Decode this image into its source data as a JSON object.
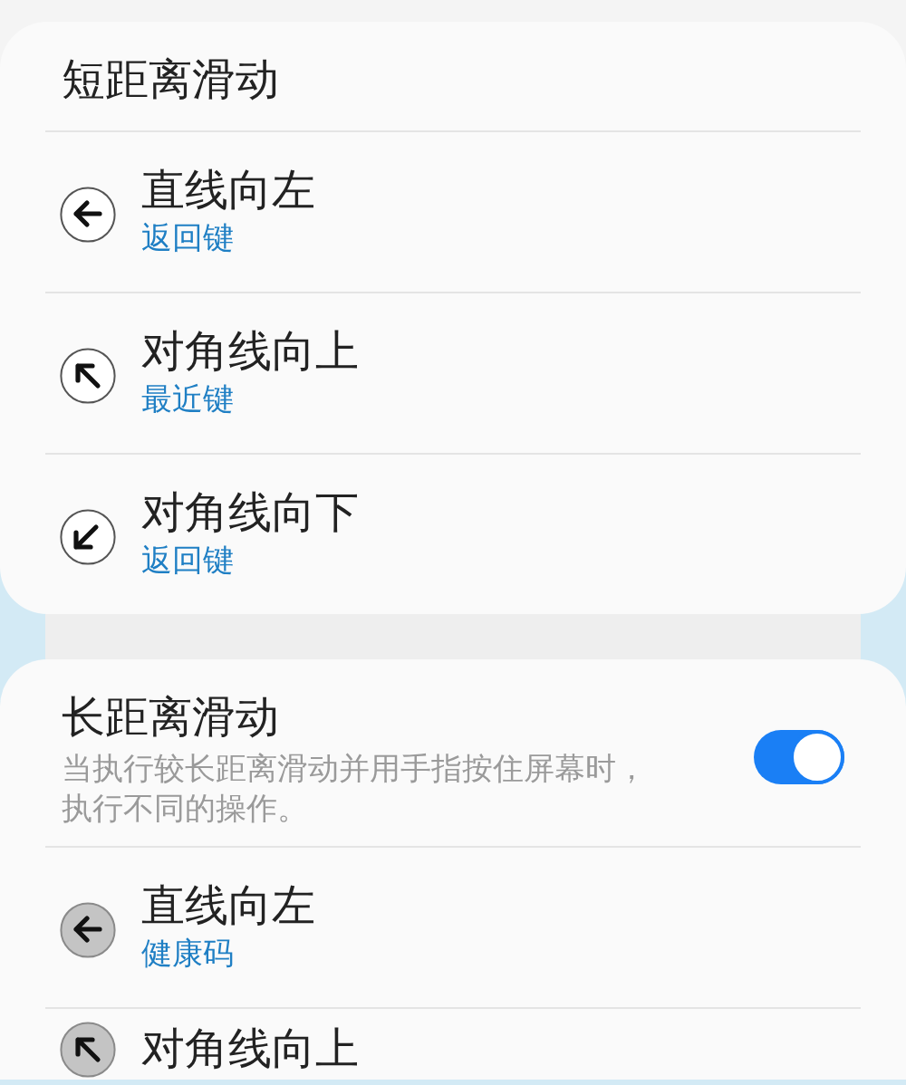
{
  "sections": [
    {
      "title": "短距离滑动",
      "items": [
        {
          "title": "直线向左",
          "subtitle": "返回键",
          "kind": "left",
          "filled": false
        },
        {
          "title": "对角线向上",
          "subtitle": "最近键",
          "kind": "up-left",
          "filled": false
        },
        {
          "title": "对角线向下",
          "subtitle": "返回键",
          "kind": "down-left",
          "filled": false
        }
      ]
    },
    {
      "title": "长距离滑动",
      "description": "当执行较长距离滑动并用手指按住屏幕时，执行不同的操作。",
      "toggle": {
        "on": true
      },
      "items": [
        {
          "title": "直线向左",
          "subtitle": "健康码",
          "kind": "left",
          "filled": true
        },
        {
          "title": "对角线向上",
          "kind": "up-left",
          "filled": true
        }
      ]
    }
  ]
}
